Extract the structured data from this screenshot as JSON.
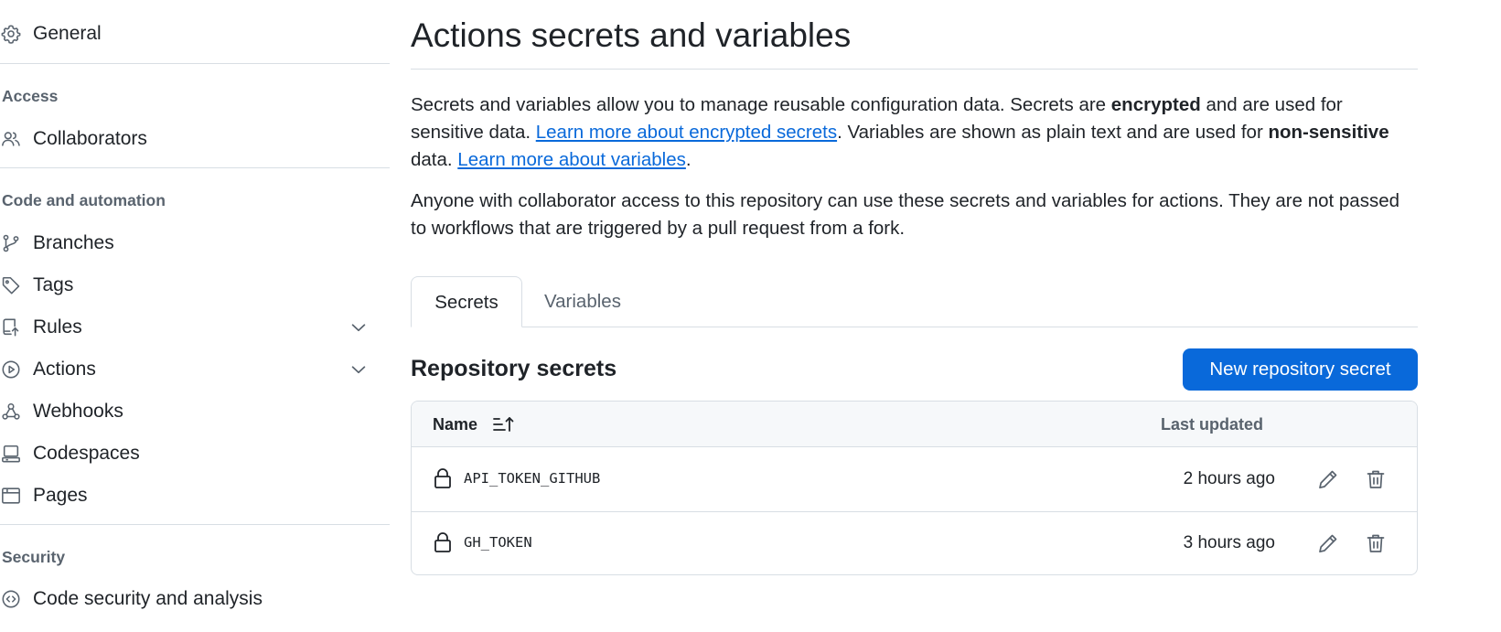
{
  "sidebar": {
    "general": "General",
    "sections": {
      "access": "Access",
      "code_automation": "Code and automation",
      "security": "Security"
    },
    "items": {
      "collaborators": "Collaborators",
      "branches": "Branches",
      "tags": "Tags",
      "rules": "Rules",
      "actions": "Actions",
      "webhooks": "Webhooks",
      "codespaces": "Codespaces",
      "pages": "Pages",
      "code_security": "Code security and analysis"
    }
  },
  "main": {
    "title": "Actions secrets and variables",
    "desc1": {
      "p1": "Secrets and variables allow you to manage reusable configuration data. Secrets are ",
      "b1": "encrypted",
      "p2": " and are used for sensitive data. ",
      "link1": "Learn more about encrypted secrets",
      "p3": ". Variables are shown as plain text and are used for ",
      "b2": "non-sensitive",
      "p4": " data. ",
      "link2": "Learn more about variables",
      "p5": "."
    },
    "desc2": "Anyone with collaborator access to this repository can use these secrets and variables for actions. They are not passed to workflows that are triggered by a pull request from a fork.",
    "tabs": {
      "secrets": "Secrets",
      "variables": "Variables"
    },
    "section_title": "Repository secrets",
    "new_secret_button": "New repository secret",
    "table": {
      "col_name": "Name",
      "col_updated": "Last updated",
      "rows": [
        {
          "name": "API_TOKEN_GITHUB",
          "updated": "2 hours ago"
        },
        {
          "name": "GH_TOKEN",
          "updated": "3 hours ago"
        }
      ]
    }
  },
  "colors": {
    "accent": "#0969da",
    "text": "#1f2328",
    "muted": "#59636e",
    "border": "#d8dee4",
    "header_bg": "#f6f8fa"
  }
}
